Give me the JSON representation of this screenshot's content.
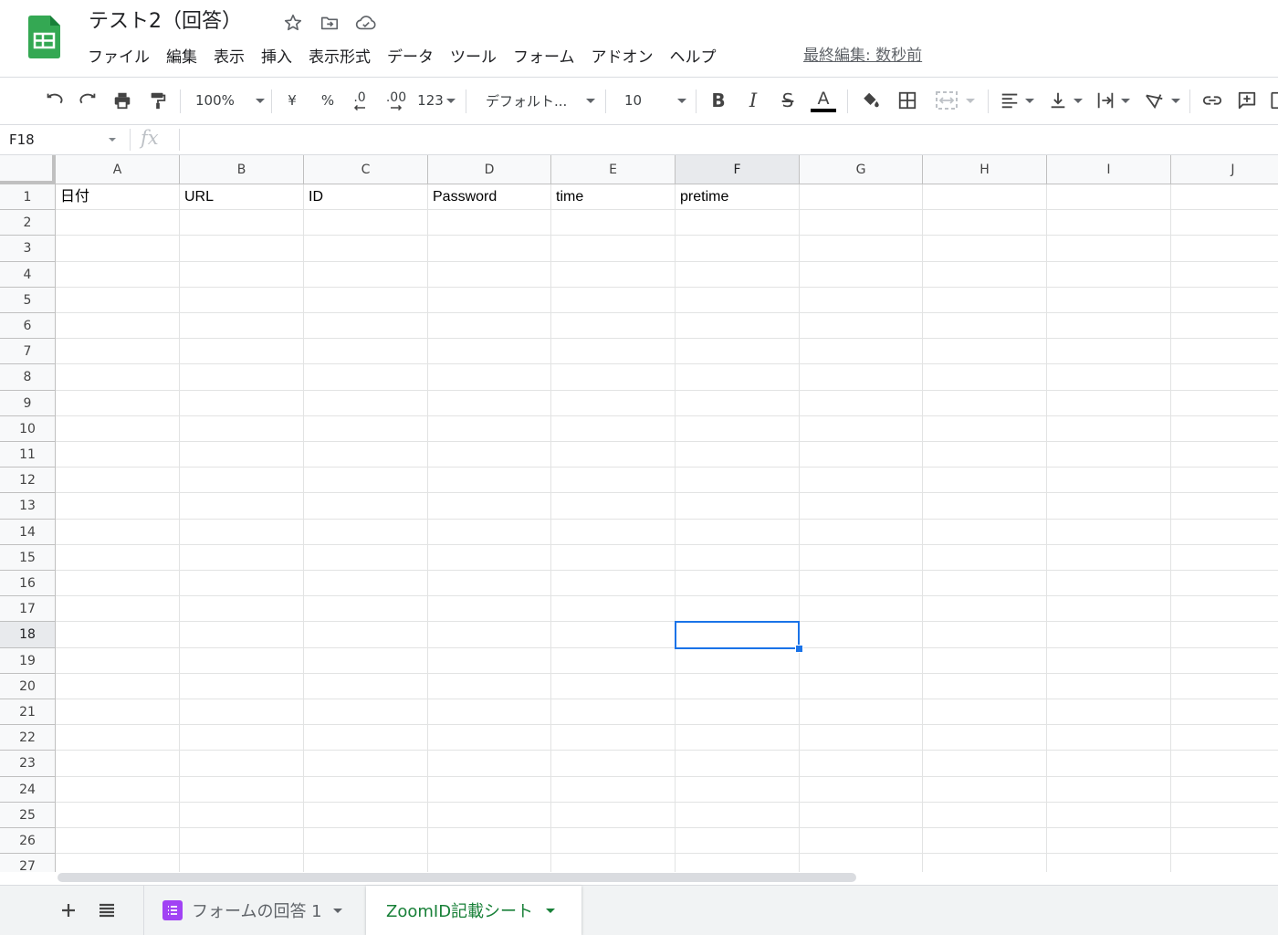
{
  "document": {
    "title": "テスト2（回答）"
  },
  "menu": [
    "ファイル",
    "編集",
    "表示",
    "挿入",
    "表示形式",
    "データ",
    "ツール",
    "フォーム",
    "アドオン",
    "ヘルプ"
  ],
  "last_edit": "最終編集: 数秒前",
  "toolbar": {
    "zoom": "100%",
    "currency": "¥",
    "percent": "%",
    "decimal_decrease": ".0",
    "decimal_increase": ".00",
    "more_formats": "123",
    "font": "デフォルト...",
    "font_size": "10",
    "bold": "B",
    "italic": "I",
    "strikethrough": "S",
    "text_color": "A",
    "text_color_value": "#000000"
  },
  "formula_bar": {
    "name_box": "F18",
    "fx": "fx",
    "value": ""
  },
  "grid": {
    "columns": [
      "A",
      "B",
      "C",
      "D",
      "E",
      "F",
      "G",
      "H",
      "I",
      "J"
    ],
    "rows": [
      "1",
      "2",
      "3",
      "4",
      "5",
      "6",
      "7",
      "8",
      "9",
      "10",
      "11",
      "12",
      "13",
      "14",
      "15",
      "16",
      "17",
      "18",
      "19",
      "20",
      "21",
      "22",
      "23",
      "24",
      "25",
      "26",
      "27"
    ],
    "row1": [
      "日付",
      "URL",
      "ID",
      "Password",
      "time",
      "pretime",
      "",
      "",
      "",
      ""
    ],
    "selected_cell": "F18",
    "selected_column": "F",
    "selected_row": "18",
    "selection_color": "#1a73e8"
  },
  "sheets": [
    {
      "label": "フォームの回答 1",
      "active": false
    },
    {
      "label": "ZoomID記載シート",
      "active": true
    }
  ],
  "colors": {
    "accent": "#188038",
    "form_tab_icon": "#a142f4",
    "logo": "#34a853"
  }
}
